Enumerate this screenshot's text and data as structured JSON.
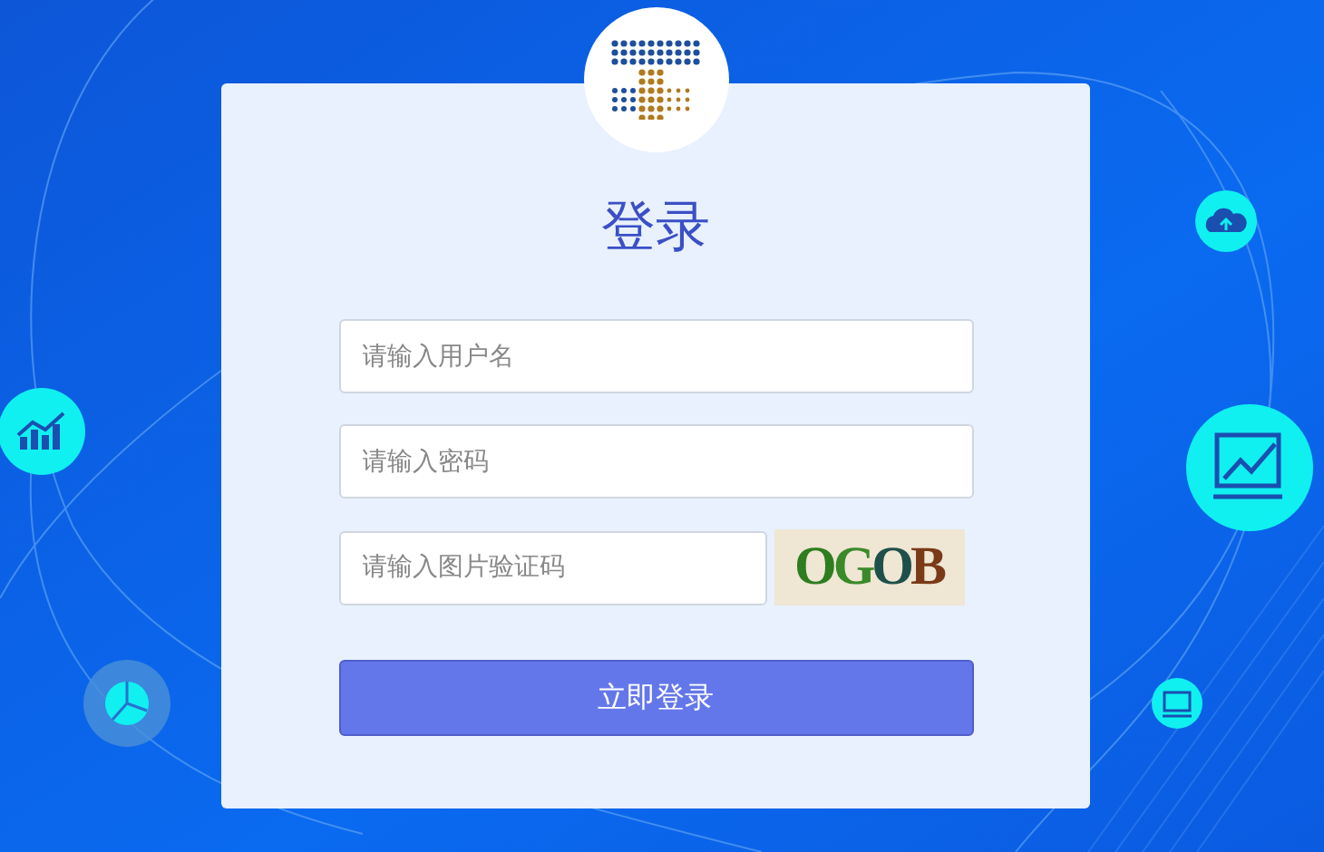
{
  "title": "登录",
  "fields": [
    {
      "placeholder": "请输入用户名"
    },
    {
      "placeholder": "请输入密码"
    },
    {
      "placeholder": "请输入图片验证码",
      "captcha": "OGOB"
    }
  ],
  "submit_button": "立即登录"
}
